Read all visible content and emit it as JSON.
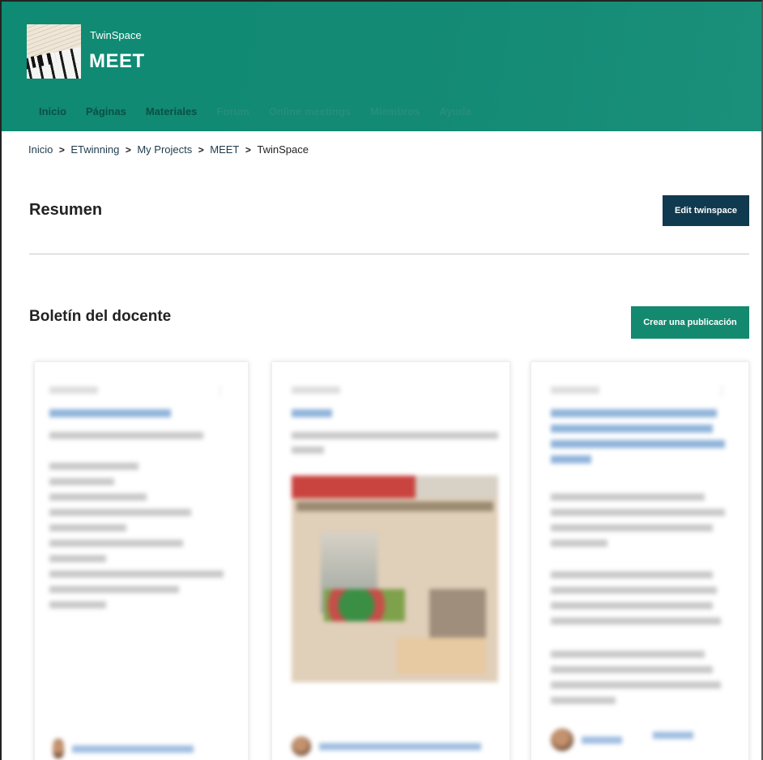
{
  "app": {
    "subtitle": "TwinSpace",
    "title": "MEET"
  },
  "nav": {
    "items": [
      "Inicio",
      "Páginas",
      "Materiales",
      "Forum",
      "Online meetings",
      "Miembros",
      "Ayuda"
    ]
  },
  "breadcrumb": {
    "items": [
      "Inicio",
      "ETwinning",
      "My Projects",
      "MEET",
      "TwinSpace"
    ],
    "separator": ">"
  },
  "summary": {
    "heading": "Resumen",
    "edit_button": "Edit twinspace"
  },
  "bulletin": {
    "heading": "Boletín del docente",
    "create_button": "Crear una publicación"
  },
  "colors": {
    "header_bg": "#138a74",
    "nav_text": "#0b4f45",
    "edit_button_bg": "#103a4f",
    "create_button_bg": "#13896f"
  },
  "icons": {
    "breadcrumb_separator": "chevron-right-icon",
    "card_menu": "more-vertical-icon"
  }
}
